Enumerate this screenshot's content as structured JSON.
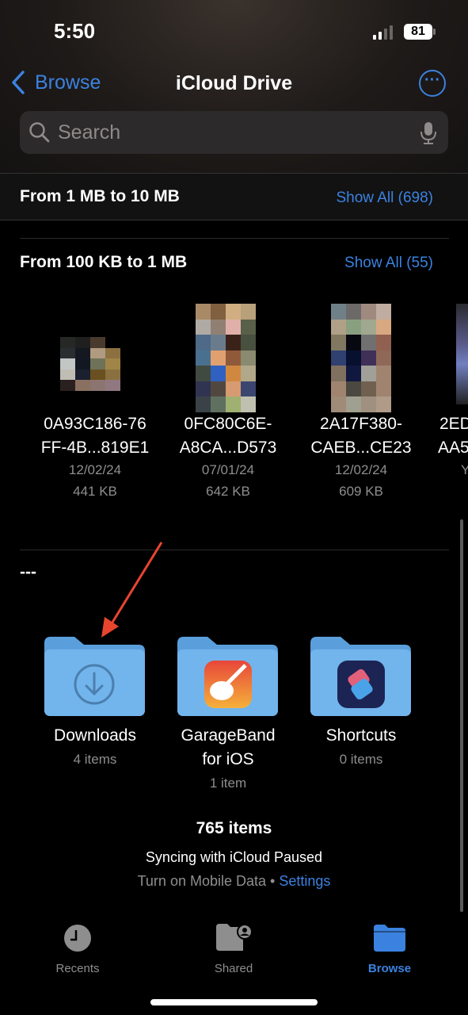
{
  "status_bar": {
    "time": "5:50",
    "battery": "81"
  },
  "nav": {
    "back_label": "Browse",
    "title": "iCloud Drive",
    "more_icon": "ellipsis-circle-icon"
  },
  "search": {
    "placeholder": "Search"
  },
  "sections": [
    {
      "title": "From 1 MB to 10 MB",
      "show_all": "Show All (698)"
    },
    {
      "title": "From 100 KB to 1 MB",
      "show_all": "Show All (55)",
      "files": [
        {
          "name1": "0A93C186-76",
          "name2": "FF-4B...819E1",
          "date": "12/02/24",
          "size": "441 KB"
        },
        {
          "name1": "0FC80C6E-",
          "name2": "A8CA...D573",
          "date": "07/01/24",
          "size": "642 KB"
        },
        {
          "name1": "2A17F380-",
          "name2": "CAEB...CE23",
          "date": "12/02/24",
          "size": "609 KB"
        },
        {
          "name1": "2ED",
          "name2": "AA5",
          "date": "Y"
        }
      ]
    },
    {
      "title": "---",
      "folders": [
        {
          "name": "Downloads",
          "count": "4 items"
        },
        {
          "name1": "GarageBand",
          "name2": "for iOS",
          "count": "1 item"
        },
        {
          "name": "Shortcuts",
          "count": "0 items"
        }
      ]
    }
  ],
  "footer": {
    "count": "765 items",
    "sync": "Syncing with iCloud Paused",
    "mobile": "Turn on Mobile Data",
    "dot": "•",
    "settings": "Settings"
  },
  "tabs": [
    {
      "label": "Recents",
      "icon": "clock-icon"
    },
    {
      "label": "Shared",
      "icon": "shared-folder-icon"
    },
    {
      "label": "Browse",
      "icon": "folder-icon",
      "active": true
    }
  ],
  "colors": {
    "accent": "#3b82e0",
    "folder": "#6fb1ea",
    "annotation": "#e8452f"
  }
}
